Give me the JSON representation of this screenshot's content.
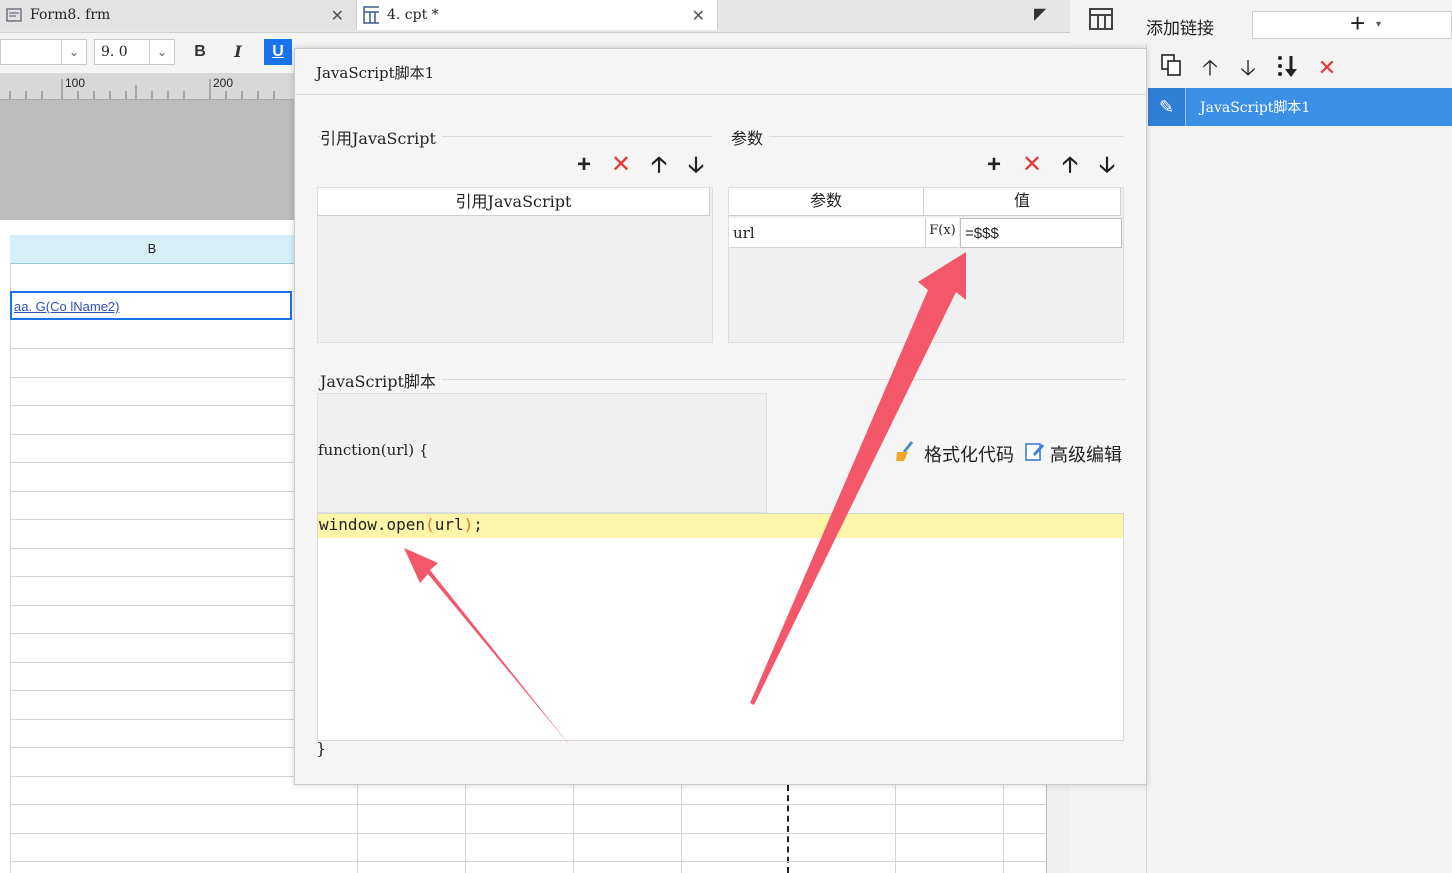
{
  "tabs": [
    {
      "label": "Form8. frm",
      "icon": "form-file-icon"
    },
    {
      "label": "4. cpt *",
      "icon": "report-file-icon"
    }
  ],
  "toolbar": {
    "font_name_value": "",
    "font_size_value": "9. 0",
    "bold_label": "B",
    "italic_label": "I",
    "underline_label": "U"
  },
  "ruler": {
    "ticks": [
      "100",
      "200"
    ]
  },
  "sheet": {
    "column_header": "B",
    "selected_cell_text": "aa. G(Co lName2)"
  },
  "right_panel": {
    "add_link_label": "添加链接",
    "items": [
      {
        "label": "JavaScript脚本1",
        "selected": true
      }
    ]
  },
  "dialog": {
    "title": "JavaScript脚本1",
    "ref_js_section": "引用JavaScript",
    "ref_js_column": "引用JavaScript",
    "params_section": "参数",
    "params_columns": [
      "参数",
      "值"
    ],
    "params_rows": [
      {
        "name": "url",
        "value": "=$$$",
        "formula_label": "F(x)"
      }
    ],
    "script_section": "JavaScript脚本",
    "function_header": "function(url) {",
    "format_code_label": "格式化代码",
    "advanced_edit_label": "高级编辑",
    "code_line": {
      "text": "window.open(url);"
    },
    "closing_brace": "}"
  },
  "colors": {
    "accent_blue": "#3b8fe6",
    "delete_red": "#e53935",
    "annotation_arrow": "#f4566a",
    "code_highlight": "#fdf6a8"
  }
}
